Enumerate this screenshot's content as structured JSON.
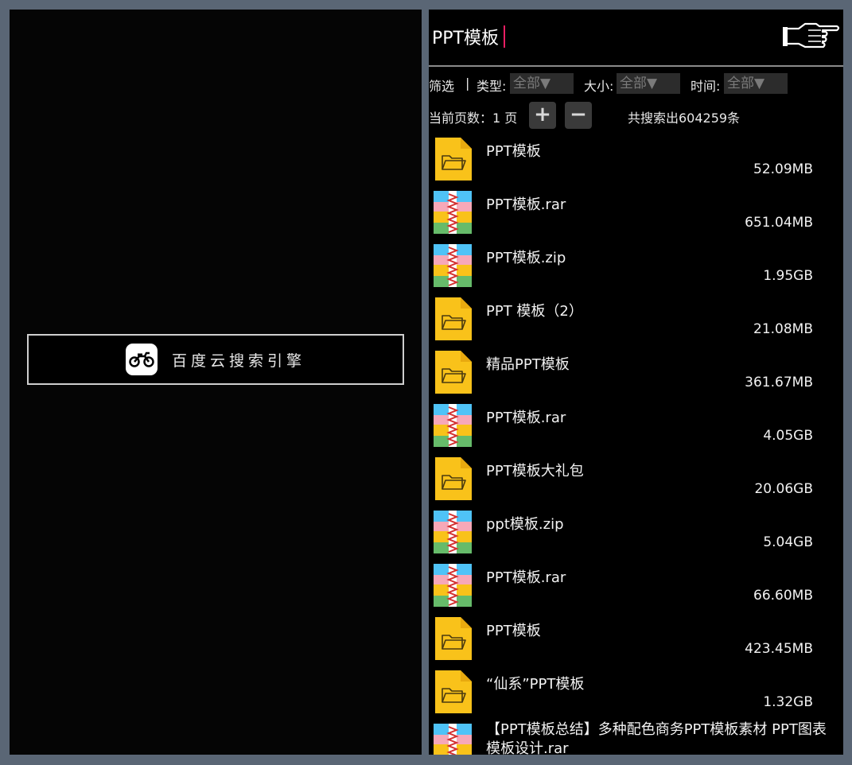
{
  "left_panel": {
    "engine_button_label": "百度云搜索引擎",
    "engine_icon": "motorcycle-icon"
  },
  "search": {
    "query": "PPT模板",
    "submit_icon": "pointing-hand-icon"
  },
  "filters": {
    "label": "筛选",
    "separator": "|",
    "type_label": "类型:",
    "type_value": "全部▼",
    "size_label": "大小:",
    "size_value": "全部▼",
    "time_label": "时间:",
    "time_value": "全部▼"
  },
  "pagination": {
    "current_page_text": "当前页数：1 页",
    "plus": "+",
    "minus": "−",
    "total_text": "共搜索出604259条"
  },
  "results": [
    {
      "name": "PPT模板",
      "size": "52.09MB",
      "icon": "folder"
    },
    {
      "name": "PPT模板.rar",
      "size": "651.04MB",
      "icon": "archive"
    },
    {
      "name": "PPT模板.zip",
      "size": "1.95GB",
      "icon": "archive"
    },
    {
      "name": "PPT 模板（2）",
      "size": "21.08MB",
      "icon": "folder"
    },
    {
      "name": "精品PPT模板",
      "size": "361.67MB",
      "icon": "folder"
    },
    {
      "name": "PPT模板.rar",
      "size": "4.05GB",
      "icon": "archive"
    },
    {
      "name": "PPT模板大礼包",
      "size": "20.06GB",
      "icon": "folder"
    },
    {
      "name": "ppt模板.zip",
      "size": "5.04GB",
      "icon": "archive"
    },
    {
      "name": "PPT模板.rar",
      "size": "66.60MB",
      "icon": "archive"
    },
    {
      "name": "PPT模板",
      "size": "423.45MB",
      "icon": "folder"
    },
    {
      "name": "“仙系”PPT模板",
      "size": "1.32GB",
      "icon": "folder"
    },
    {
      "name": "【PPT模板总结】多种配色商务PPT模板素材 PPT图表 模板设计.rar",
      "size": "",
      "icon": "archive"
    }
  ],
  "colors": {
    "folder": "#f9c21a",
    "folder_dark": "#e8a90f",
    "caret": "#e91e63"
  }
}
